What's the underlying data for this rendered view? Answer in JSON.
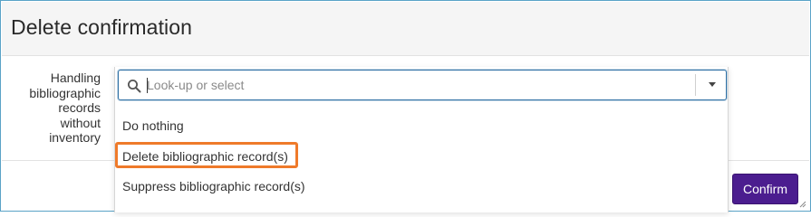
{
  "dialog": {
    "title": "Delete confirmation"
  },
  "field": {
    "label": "Handling bibliographic records without inventory"
  },
  "combo": {
    "placeholder": "Look-up or select",
    "options": [
      {
        "label": "Do nothing"
      },
      {
        "label": "Delete bibliographic record(s)"
      },
      {
        "label": "Suppress bibliographic record(s)"
      }
    ],
    "highlighted_index": 1
  },
  "footer": {
    "confirm_label": "Confirm"
  },
  "colors": {
    "accent_purple": "#4b1d8f",
    "highlight_orange": "#ef7a2a",
    "focus_blue": "#2c6ea3"
  },
  "icons": {
    "search": "search-icon",
    "dropdown": "chevron-down-icon",
    "resize": "resize-grip-icon"
  }
}
